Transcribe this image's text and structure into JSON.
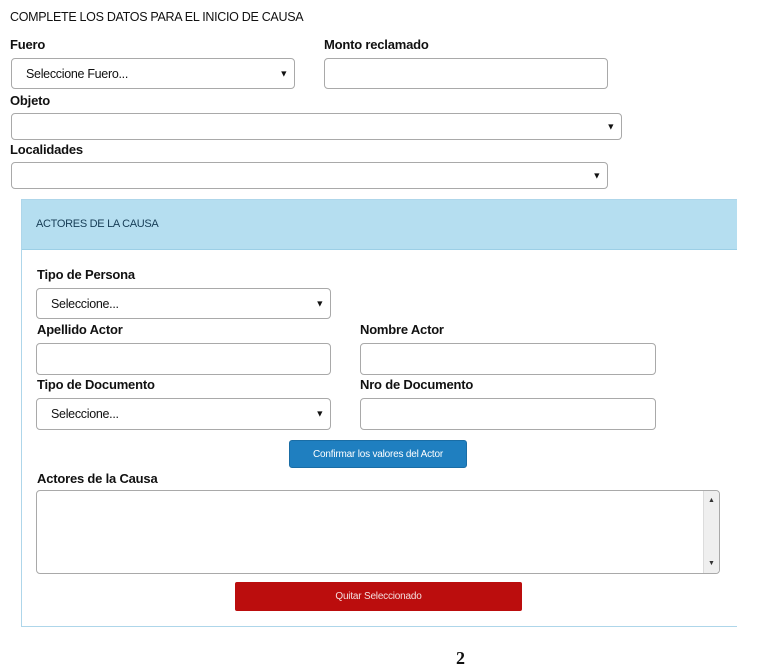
{
  "form": {
    "title": "COMPLETE LOS DATOS PARA EL INICIO DE CAUSA",
    "fuero": {
      "label": "Fuero",
      "selected": "Seleccione Fuero..."
    },
    "monto": {
      "label": "Monto reclamado",
      "value": ""
    },
    "objeto": {
      "label": "Objeto",
      "selected": ""
    },
    "localidades": {
      "label": "Localidades",
      "selected": ""
    }
  },
  "actores_panel": {
    "title": "ACTORES DE LA CAUSA",
    "tipo_persona": {
      "label": "Tipo de Persona",
      "selected": "Seleccione..."
    },
    "apellido": {
      "label": "Apellido Actor",
      "value": ""
    },
    "nombre": {
      "label": "Nombre Actor",
      "value": ""
    },
    "tipo_documento": {
      "label": "Tipo de Documento",
      "selected": "Seleccione..."
    },
    "nro_documento": {
      "label": "Nro de Documento",
      "value": ""
    },
    "confirm_button": "Confirmar los valores del Actor",
    "actores_list_label": "Actores de la Causa",
    "remove_button": "Quitar Seleccionado"
  },
  "page_number": "2",
  "colors": {
    "panel_header": "#b5def0",
    "confirm_button": "#1f7fc0",
    "remove_button": "#bb0d0d"
  },
  "icons": {
    "dropdown": "chevron-down-icon",
    "scroll_up": "scroll-up-icon",
    "scroll_down": "scroll-down-icon"
  }
}
